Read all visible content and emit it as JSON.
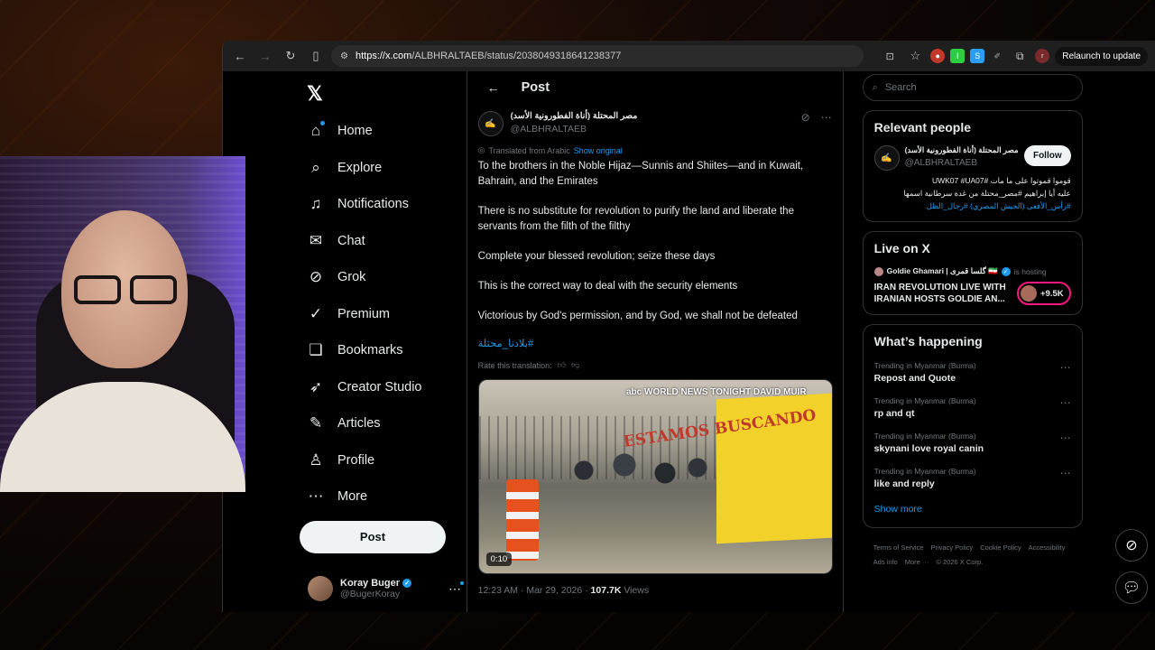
{
  "browser": {
    "url_host": "https://x.com",
    "url_path": "/ALBHRALTAEB/status/2038049318641238377",
    "relaunch": "Relaunch to update"
  },
  "nav": {
    "items": [
      {
        "label": "Home",
        "icon": "home-icon",
        "glyph": "⌂"
      },
      {
        "label": "Explore",
        "icon": "search-icon",
        "glyph": "⌕"
      },
      {
        "label": "Notifications",
        "icon": "bell-icon",
        "glyph": "♫"
      },
      {
        "label": "Chat",
        "icon": "mail-icon",
        "glyph": "✉"
      },
      {
        "label": "Grok",
        "icon": "grok-icon",
        "glyph": "⊘"
      },
      {
        "label": "Premium",
        "icon": "premium-icon",
        "glyph": "✓"
      },
      {
        "label": "Bookmarks",
        "icon": "bookmark-icon",
        "glyph": "❏"
      },
      {
        "label": "Creator Studio",
        "icon": "rocket-icon",
        "glyph": "➶"
      },
      {
        "label": "Articles",
        "icon": "article-icon",
        "glyph": "✎"
      },
      {
        "label": "Profile",
        "icon": "person-icon",
        "glyph": "♙"
      },
      {
        "label": "More",
        "icon": "more-icon",
        "glyph": "⋯"
      }
    ],
    "post_button": "Post",
    "account": {
      "name": "Koray Buger",
      "handle": "@BugerKoray"
    }
  },
  "post": {
    "header_title": "Post",
    "author_name": "مصر المحتلة (أناة الفطورونية الأسد)",
    "author_handle": "@ALBHRALTAEB",
    "translated_label": "Translated from Arabic",
    "show_original": "Show original",
    "paragraphs": [
      "To the brothers in the Noble Hijaz—Sunnis and Shiites—and in Kuwait, Bahrain, and the Emirates",
      "There is no substitute for revolution to purify the land and liberate the servants from the filth of the filthy",
      "Complete your blessed revolution; seize these days",
      "This is the correct way to deal with the security elements",
      "Victorious by God's permission, and by God, we shall not be defeated"
    ],
    "hashtag": "#بلادنا_محتلة",
    "rate_label": "Rate this translation:",
    "video_time": "0:10",
    "video_logo": "abc WORLD NEWS TONIGHT DAVID MUIR",
    "video_sign": "ESTAMOS BUSCANDO",
    "timestamp": "12:23 AM · Mar 29, 2026 · ",
    "views_count": "107.7K",
    "views_label": " Views"
  },
  "sidebar": {
    "search_placeholder": "Search",
    "relevant": {
      "title": "Relevant people",
      "name": "مصر المحتلة (أناة الفطورونية الأسد)",
      "handle": "@ALBHRALTAEB",
      "follow": "Follow",
      "bio_line1": "قوموا قموتوا على ما مات #UWK07 #UA07",
      "bio_line2": "عليه أيا إبراهيم #مصر_محتلة من غدة سرطانية اسمها",
      "bio_line3": "#رأس_الأفعى (الجيش المصري) #رجال_الظل"
    },
    "live": {
      "title": "Live on X",
      "host": "Goldie Ghamari | گلسا قمری 🇮🇷",
      "hosting": "is hosting",
      "broadcast": "IRAN REVOLUTION LIVE WITH IRANIAN HOSTS GOLDIE AN...",
      "listeners": "+9.5K"
    },
    "happening": {
      "title": "What’s happening",
      "trends": [
        {
          "context": "Trending in Myanmar (Burma)",
          "name": "Repost and Quote"
        },
        {
          "context": "Trending in Myanmar (Burma)",
          "name": "rp and qt"
        },
        {
          "context": "Trending in Myanmar (Burma)",
          "name": "skynani love royal canin"
        },
        {
          "context": "Trending in Myanmar (Burma)",
          "name": "like and reply"
        }
      ],
      "show_more": "Show more"
    },
    "footer": [
      "Terms of Service",
      "Privacy Policy",
      "Cookie Policy",
      "Accessibility",
      "Ads info",
      "More ···",
      "© 2026 X Corp."
    ]
  },
  "colors": {
    "accent": "#1d9bf0",
    "border": "#2f3336",
    "muted": "#71767b"
  }
}
